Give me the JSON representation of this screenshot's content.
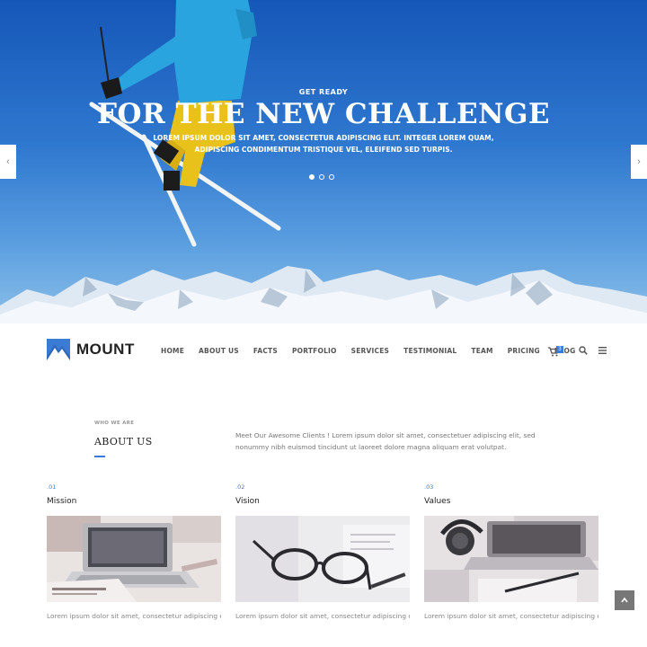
{
  "hero": {
    "eyebrow": "GET READY",
    "headline": "FOR THE NEW CHALLENGE",
    "subtext_line1": "LOREM IPSUM DOLOR SIT AMET, CONSECTETUR ADIPISCING ELIT. INTEGER LOREM QUAM,",
    "subtext_line2": "ADIPISCING CONDIMENTUM TRISTIQUE VEL, ELEIFEND SED TURPIS.",
    "prev_glyph": "‹",
    "next_glyph": "›",
    "slides_count": 3,
    "active_slide": 1
  },
  "brand": {
    "name": "MOUNT",
    "accent": "#3a7bd5"
  },
  "nav": {
    "items": [
      "HOME",
      "ABOUT US",
      "FACTS",
      "PORTFOLIO",
      "SERVICES",
      "TESTIMONIAL",
      "TEAM",
      "PRICING",
      "BLOG"
    ],
    "cart_count": "3",
    "icons": [
      "cart-icon",
      "search-icon",
      "menu-icon"
    ]
  },
  "about": {
    "eyebrow": "WHO WE ARE",
    "title": "ABOUT US",
    "text": "Meet Our Awesome Clients ! Lorem ipsum dolor sit amet, consectetuer adipiscing elit, sed nonummy nibh euismod tincidunt ut laoreet dolore magna aliquam erat volutpat."
  },
  "columns": [
    {
      "num": ".01",
      "title": "Mission",
      "image": "laptop-newspaper-photo",
      "text": "Lorem ipsum dolor sit amet, consectetur adipiscing elit."
    },
    {
      "num": ".02",
      "title": "Vision",
      "image": "glasses-desk-photo",
      "text": "Lorem ipsum dolor sit amet, consectetur adipiscing elit."
    },
    {
      "num": ".03",
      "title": "Values",
      "image": "laptop-headphones-photo",
      "text": "Lorem ipsum dolor sit amet, consectetur adipiscing elit."
    }
  ],
  "back_to_top_icon": "chevron-up-icon"
}
